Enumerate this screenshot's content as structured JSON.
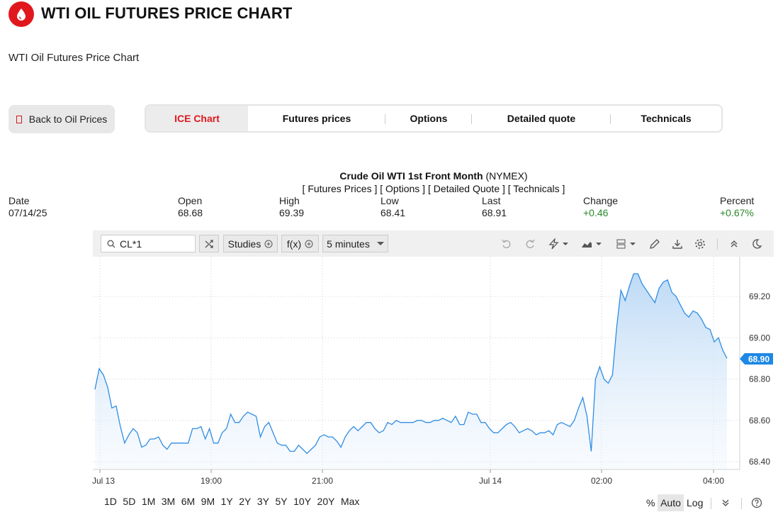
{
  "header": {
    "title": "WTI OIL FUTURES PRICE CHART",
    "subtitle": "WTI Oil Futures Price Chart",
    "logo_icon": "oil-drop-icon"
  },
  "nav": {
    "back_label": "Back to Oil Prices",
    "tabs": [
      {
        "label": "ICE Chart",
        "active": true
      },
      {
        "label": "Futures prices",
        "active": false
      },
      {
        "label": "Options",
        "active": false
      },
      {
        "label": "Detailed quote",
        "active": false
      },
      {
        "label": "Technicals",
        "active": false
      }
    ]
  },
  "quote": {
    "name": "Crude Oil WTI 1st Front Month",
    "exchange": "(NYMEX)",
    "links": "[ Futures Prices ] [ Options ] [ Detailed Quote ] [ Technicals ]",
    "labels": {
      "date": "Date",
      "open": "Open",
      "high": "High",
      "low": "Low",
      "last": "Last",
      "change": "Change",
      "percent": "Percent"
    },
    "values": {
      "date": "07/14/25",
      "open": "68.68",
      "high": "69.39",
      "low": "68.41",
      "last": "68.91",
      "change": "+0.46",
      "percent": "+0.67%"
    }
  },
  "toolbar": {
    "symbol": "CL*1",
    "studies_label": "Studies",
    "fx_label": "f(x)",
    "interval_label": "5 minutes",
    "icons": [
      "search-icon",
      "compare-icon",
      "add-icon",
      "chevron-down-icon",
      "undo-icon",
      "redo-icon",
      "events-icon",
      "chart-style-icon",
      "layout-icon",
      "draw-icon",
      "download-icon",
      "settings-icon",
      "collapse-icon",
      "dark-mode-icon"
    ]
  },
  "colors": {
    "accent": "#e0181e",
    "line": "#2f8de4",
    "positive": "#2a8a2a",
    "price_tag": "#1e88e5"
  },
  "chart_data": {
    "type": "area",
    "title": "",
    "xlabel": "",
    "ylabel": "",
    "ylim": [
      68.37,
      69.4
    ],
    "x_ticks": [
      "Jul 13",
      "19:00",
      "21:00",
      "Jul 14",
      "02:00",
      "04:00"
    ],
    "y_ticks": [
      "68.40",
      "68.60",
      "68.80",
      "69.00",
      "69.20"
    ],
    "last_price_label": "68.90",
    "grid": true,
    "series": [
      {
        "values": [
          68.75,
          68.85,
          68.82,
          68.76,
          68.66,
          68.67,
          68.57,
          68.49,
          68.53,
          68.56,
          68.54,
          68.47,
          68.48,
          68.51,
          68.51,
          68.52,
          68.48,
          68.46,
          68.49,
          68.49,
          68.49,
          68.49,
          68.49,
          68.56,
          68.56,
          68.57,
          68.51,
          68.56,
          68.49,
          68.49,
          68.54,
          68.56,
          68.63,
          68.59,
          68.59,
          68.62,
          68.64,
          68.63,
          68.62,
          68.52,
          68.57,
          68.59,
          68.54,
          68.49,
          68.48,
          68.48,
          68.45,
          68.45,
          68.48,
          68.46,
          68.44,
          68.46,
          68.48,
          68.52,
          68.53,
          68.52,
          68.52,
          68.5,
          68.47,
          68.52,
          68.55,
          68.57,
          68.55,
          68.57,
          68.59,
          68.59,
          68.56,
          68.54,
          68.55,
          68.59,
          68.58,
          68.6,
          68.59,
          68.59,
          68.59,
          68.59,
          68.6,
          68.6,
          68.59,
          68.59,
          68.6,
          68.6,
          68.61,
          68.6,
          68.59,
          68.62,
          68.58,
          68.58,
          68.64,
          68.63,
          68.63,
          68.59,
          68.59,
          68.56,
          68.54,
          68.54,
          68.56,
          68.58,
          68.59,
          68.57,
          68.54,
          68.55,
          68.56,
          68.55,
          68.53,
          68.54,
          68.54,
          68.55,
          68.53,
          68.58,
          68.59,
          68.58,
          68.57,
          68.6,
          68.66,
          68.71,
          68.62,
          68.45,
          68.8,
          68.86,
          68.8,
          68.78,
          68.82,
          69.05,
          69.23,
          69.18,
          69.25,
          69.31,
          69.31,
          69.26,
          69.23,
          69.2,
          69.17,
          69.24,
          69.27,
          69.28,
          69.22,
          69.2,
          69.16,
          69.12,
          69.1,
          69.13,
          69.12,
          69.09,
          69.05,
          69.04,
          68.98,
          69.0,
          68.94,
          68.9
        ]
      }
    ]
  },
  "footer": {
    "ranges": [
      "1D",
      "5D",
      "1M",
      "3M",
      "6M",
      "9M",
      "1Y",
      "2Y",
      "3Y",
      "5Y",
      "10Y",
      "20Y",
      "Max"
    ],
    "percent_label": "%",
    "auto_label": "Auto",
    "log_label": "Log"
  }
}
